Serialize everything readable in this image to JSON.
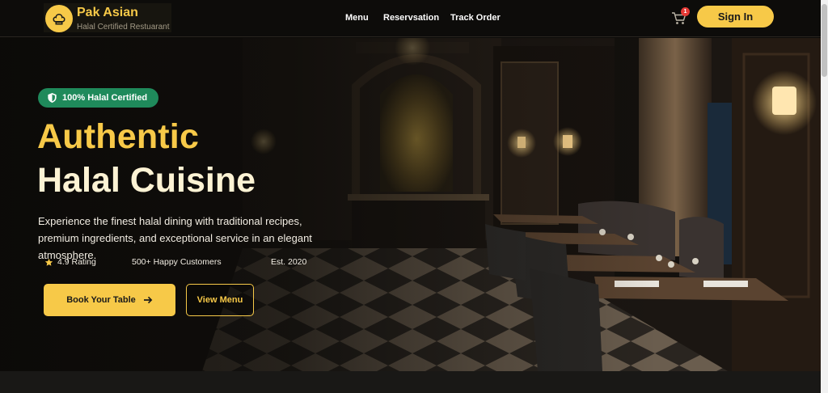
{
  "brand": {
    "name": "Pak Asian",
    "tagline": "Halal Certified Restuarant"
  },
  "nav": {
    "items": [
      {
        "label": "Menu"
      },
      {
        "label": "Reservsation"
      },
      {
        "label": "Track Order"
      }
    ]
  },
  "cart": {
    "count": "1"
  },
  "header": {
    "signin_label": "Sign In"
  },
  "hero": {
    "badge": "100% Halal Certified",
    "title_line1": "Authentic",
    "title_line2": "Halal Cuisine",
    "description": "Experience the finest halal dining with traditional recipes, premium ingredients, and exceptional service in an elegant atmosphere.",
    "stats": [
      {
        "label": "4.9 Rating",
        "icon": "star-icon"
      },
      {
        "label": "500+ Happy Customers"
      },
      {
        "label": "Est. 2020"
      }
    ],
    "primary_cta": "Book Your Table",
    "secondary_cta": "View Menu"
  },
  "colors": {
    "accent": "#f7c948",
    "badge_green": "#1f8a5b",
    "background": "#0b0a08"
  }
}
